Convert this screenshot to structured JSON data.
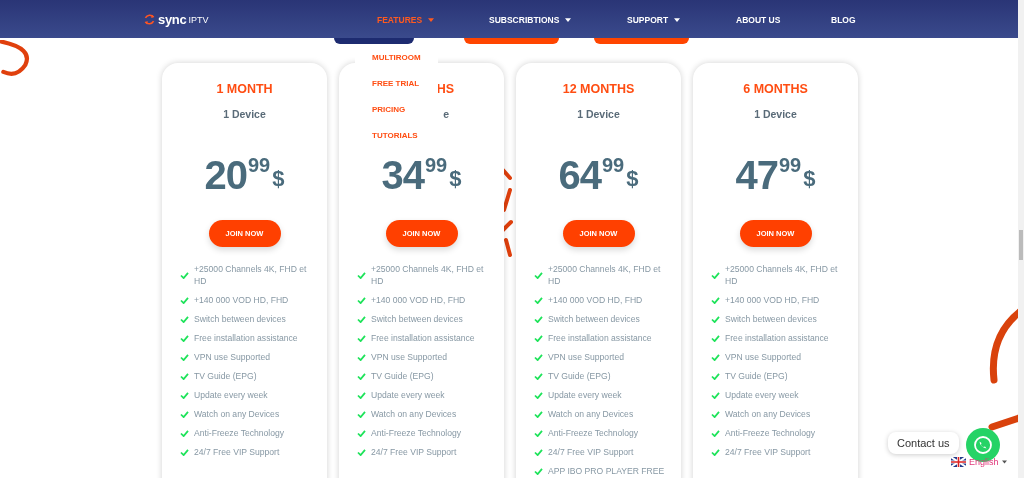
{
  "nav": {
    "logo_main": "sync",
    "logo_sub": "IPTV",
    "items": [
      {
        "label": "FEATURES",
        "selected": true,
        "has_caret": true
      },
      {
        "label": "SUBSCRIBTIONS",
        "selected": false,
        "has_caret": true
      },
      {
        "label": "SUPPORT",
        "selected": false,
        "has_caret": true
      },
      {
        "label": "ABOUT US",
        "selected": false,
        "has_caret": false
      },
      {
        "label": "BLOG",
        "selected": false,
        "has_caret": false
      }
    ],
    "dropdown": [
      "MULTIROOM",
      "FREE TRIAL",
      "PRICING",
      "TUTORIALS"
    ]
  },
  "plans": [
    {
      "title": "1 MONTH",
      "devices": "1 Device",
      "covered": false,
      "price": "20",
      "cents": "99",
      "currency": "$",
      "button": "JOIN NOW",
      "features": [
        "+25000 Channels 4K, FHD et HD",
        "+140 000 VOD HD, FHD",
        "Switch between devices",
        "Free installation assistance",
        "VPN use Supported",
        "TV Guide (EPG)",
        "Update every week",
        "Watch on any Devices",
        "Anti-Freeze Technology",
        "24/7 Free VIP Support"
      ]
    },
    {
      "title": "HS",
      "devices": "e",
      "covered": true,
      "price": "34",
      "cents": "99",
      "currency": "$",
      "button": "JOIN NOW",
      "features": [
        "+25000 Channels 4K, FHD et HD",
        "+140 000 VOD HD, FHD",
        "Switch between devices",
        "Free installation assistance",
        "VPN use Supported",
        "TV Guide (EPG)",
        "Update every week",
        "Watch on any Devices",
        "Anti-Freeze Technology",
        "24/7 Free VIP Support"
      ]
    },
    {
      "title": "12 MONTHS",
      "devices": "1 Device",
      "covered": false,
      "price": "64",
      "cents": "99",
      "currency": "$",
      "button": "JOIN NOW",
      "features": [
        "+25000 Channels 4K, FHD et HD",
        "+140 000 VOD HD, FHD",
        "Switch between devices",
        "Free installation assistance",
        "VPN use Supported",
        "TV Guide (EPG)",
        "Update every week",
        "Watch on any Devices",
        "Anti-Freeze Technology",
        "24/7 Free VIP Support",
        "APP IBO PRO PLAYER FREE"
      ]
    },
    {
      "title": "6 MONTHS",
      "devices": "1 Device",
      "covered": false,
      "price": "47",
      "cents": "99",
      "currency": "$",
      "button": "JOIN NOW",
      "features": [
        "+25000 Channels 4K, FHD et HD",
        "+140 000 VOD HD, FHD",
        "Switch between devices",
        "Free installation assistance",
        "VPN use Supported",
        "TV Guide (EPG)",
        "Update every week",
        "Watch on any Devices",
        "Anti-Freeze Technology",
        "24/7 Free VIP Support"
      ]
    }
  ],
  "contact": {
    "label": "Contact us"
  },
  "language": {
    "label": "English"
  }
}
